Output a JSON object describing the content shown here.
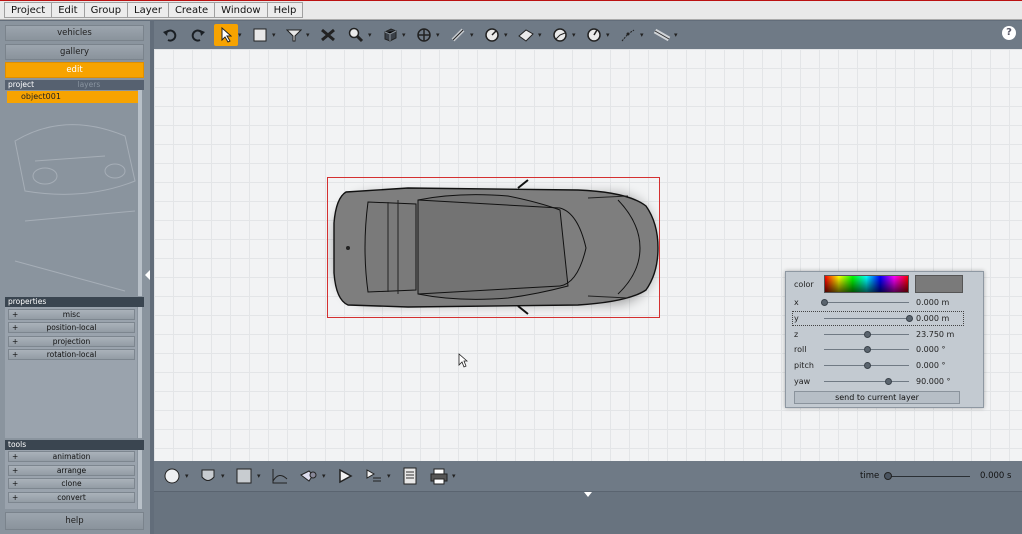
{
  "menubar": {
    "items": [
      "Project",
      "Edit",
      "Group",
      "Layer",
      "Create",
      "Window",
      "Help"
    ]
  },
  "left_panel": {
    "nav_buttons": [
      "vehicles",
      "gallery",
      "edit"
    ],
    "active_nav": "edit",
    "project_tabs": [
      "project",
      "layers"
    ],
    "selected_object": "object001",
    "properties_header": "properties",
    "properties": [
      "misc",
      "position-local",
      "projection",
      "rotation-local"
    ],
    "tools_header": "tools",
    "tools": [
      "animation",
      "arrange",
      "clone",
      "convert"
    ],
    "help_label": "help",
    "expand_symbol": "+"
  },
  "toolbar": {
    "icons": [
      "undo-icon",
      "redo-icon",
      "select-pointer-icon",
      "rectangle-select-icon",
      "filter-icon",
      "delete-icon",
      "zoom-icon",
      "cube-icon",
      "move-icon",
      "measure-icon",
      "gauge-icon",
      "area-icon",
      "angle-icon",
      "angle2-icon",
      "path-icon",
      "ruler-icon",
      "help-icon"
    ],
    "help_symbol": "?"
  },
  "bottom_toolbar": {
    "time_label": "time",
    "time_value": "0.000 s",
    "time_position": 0.0
  },
  "float_panel": {
    "color_label": "color",
    "rows": [
      {
        "label": "x",
        "value": "0.000 m",
        "position": 0.0
      },
      {
        "label": "y",
        "value": "0.000 m",
        "position": 1.0
      },
      {
        "label": "z",
        "value": "23.750 m",
        "position": 0.5
      },
      {
        "label": "roll",
        "value": "0.000 °",
        "position": 0.5
      },
      {
        "label": "pitch",
        "value": "0.000 °",
        "position": 0.5
      },
      {
        "label": "yaw",
        "value": "90.000 °",
        "position": 0.75
      }
    ],
    "send_button": "send to current layer",
    "swatch_color": "#7a7a7a"
  },
  "colors": {
    "accent": "#f7a300",
    "selection_border": "#d43030"
  }
}
